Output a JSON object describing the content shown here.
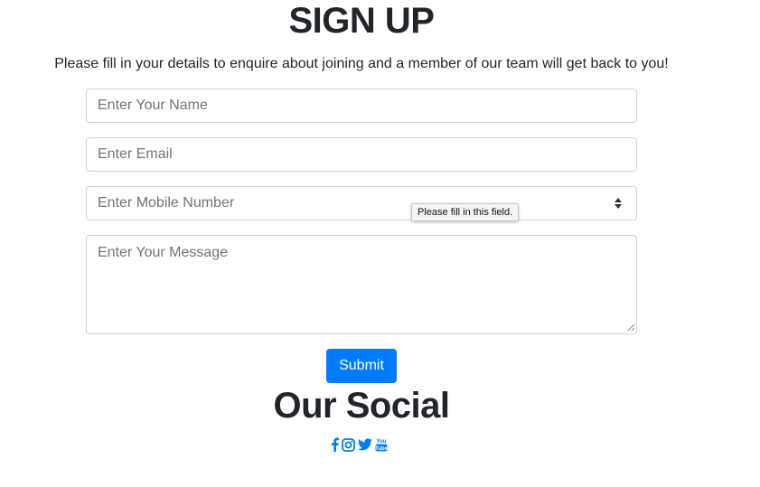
{
  "page": {
    "title": "SIGN UP",
    "intro": "Please fill in your details to enquire about joining and a member of our team will get back to you!"
  },
  "form": {
    "name_placeholder": "Enter Your Name",
    "email_placeholder": "Enter Email",
    "mobile_placeholder": "Enter Mobile Number",
    "message_placeholder": "Enter Your Message",
    "submit_label": "Submit",
    "validation_tooltip": "Please fill in this field."
  },
  "social": {
    "title": "Our Social",
    "links": [
      {
        "icon": "facebook-icon"
      },
      {
        "icon": "instagram-icon"
      },
      {
        "icon": "twitter-icon"
      },
      {
        "icon": "youtube-icon",
        "label": "You Tube"
      }
    ]
  },
  "colors": {
    "accent": "#007bff",
    "text": "#212529",
    "border": "#ced4da",
    "placeholder": "#6c757d"
  }
}
